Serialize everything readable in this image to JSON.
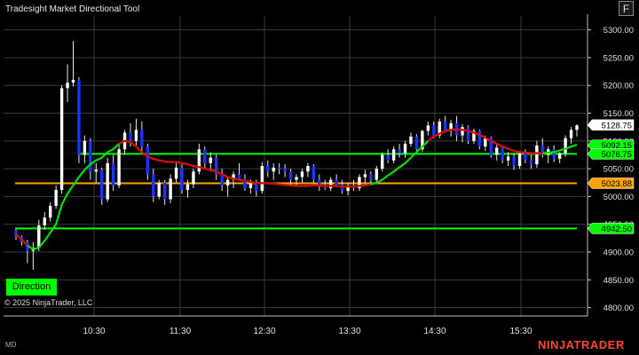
{
  "window": {
    "title": "Tradesight Market Directional Tool",
    "float_button": "F",
    "copyright": "© 2025 NinjaTrader, LLC",
    "direction_button": "Direction",
    "mode": "MD",
    "brand": "NINJATRADER"
  },
  "chart_data": {
    "type": "candlestick",
    "x_ticks": [
      "10:30",
      "11:30",
      "12:30",
      "13:30",
      "14:30",
      "15:30"
    ],
    "y_ticks": [
      "5300.00",
      "5250.00",
      "5200.00",
      "5150.00",
      "5100.00",
      "5050.00",
      "5000.00",
      "4950.00",
      "4900.00",
      "4850.00",
      "4800.00"
    ],
    "ylim": [
      4785,
      5325
    ],
    "y_tick_values": [
      5300,
      5250,
      5200,
      5150,
      5100,
      5050,
      5000,
      4950,
      4900,
      4850,
      4800
    ],
    "price_markers": [
      {
        "label": "5128.75",
        "value": 5128.75,
        "color": "#ffffff",
        "text_color": "#000000"
      },
      {
        "label": "5092.15",
        "value": 5092.15,
        "color": "#00ff00",
        "text_color": "#000000"
      },
      {
        "label": "5076.75",
        "value": 5076.75,
        "color": "#00ff00",
        "text_color": "#000000"
      },
      {
        "label": "5023.88",
        "value": 5023.88,
        "color": "#ffa500",
        "text_color": "#000000"
      },
      {
        "label": "4942.50",
        "value": 4942.5,
        "color": "#00ff00",
        "text_color": "#000000"
      }
    ],
    "horizontal_levels": [
      {
        "value": 5076.75,
        "color": "#00ff00",
        "start": 0.13
      },
      {
        "value": 5023.88,
        "color": "#ffa500",
        "start": 0.02
      },
      {
        "value": 4942.5,
        "color": "#00ff00",
        "start": 0.02
      }
    ],
    "candles": [
      [
        4940,
        4942,
        4922,
        4928
      ],
      [
        4928,
        4930,
        4912,
        4918
      ],
      [
        4918,
        4922,
        4880,
        4902
      ],
      [
        4902,
        4918,
        4868,
        4908
      ],
      [
        4908,
        4958,
        4902,
        4948
      ],
      [
        4948,
        4972,
        4940,
        4962
      ],
      [
        4962,
        4990,
        4955,
        4983
      ],
      [
        4983,
        5020,
        4978,
        5012
      ],
      [
        5012,
        5200,
        5005,
        5195
      ],
      [
        5195,
        5238,
        5170,
        5205
      ],
      [
        5205,
        5280,
        5198,
        5210
      ],
      [
        5210,
        5215,
        5060,
        5075
      ],
      [
        5075,
        5110,
        5060,
        5100
      ],
      [
        5100,
        5105,
        5030,
        5045
      ],
      [
        5045,
        5060,
        5025,
        5048
      ],
      [
        5048,
        5052,
        4985,
        4995
      ],
      [
        4995,
        5070,
        4990,
        5060
      ],
      [
        5060,
        5075,
        5010,
        5020
      ],
      [
        5020,
        5095,
        5015,
        5085
      ],
      [
        5085,
        5120,
        5075,
        5115
      ],
      [
        5115,
        5132,
        5090,
        5100
      ],
      [
        5100,
        5140,
        5092,
        5120
      ],
      [
        5120,
        5135,
        5080,
        5090
      ],
      [
        5090,
        5095,
        5030,
        5040
      ],
      [
        5040,
        5050,
        4990,
        5000
      ],
      [
        5000,
        5030,
        4995,
        5025
      ],
      [
        5025,
        5030,
        4985,
        4995
      ],
      [
        4995,
        5040,
        4988,
        5032
      ],
      [
        5032,
        5060,
        5025,
        5052
      ],
      [
        5052,
        5058,
        5005,
        5012
      ],
      [
        5012,
        5030,
        4998,
        5022
      ],
      [
        5022,
        5050,
        5015,
        5045
      ],
      [
        5045,
        5095,
        5040,
        5085
      ],
      [
        5085,
        5090,
        5050,
        5060
      ],
      [
        5060,
        5080,
        5045,
        5070
      ],
      [
        5070,
        5075,
        5030,
        5040
      ],
      [
        5040,
        5050,
        5010,
        5020
      ],
      [
        5020,
        5035,
        5000,
        5030
      ],
      [
        5030,
        5045,
        5015,
        5040
      ],
      [
        5040,
        5060,
        5030,
        5032
      ],
      [
        5032,
        5040,
        5010,
        5015
      ],
      [
        5015,
        5030,
        5005,
        5025
      ],
      [
        5025,
        5030,
        5000,
        5010
      ],
      [
        5010,
        5062,
        5005,
        5055
      ],
      [
        5055,
        5065,
        5035,
        5045
      ],
      [
        5045,
        5060,
        5030,
        5052
      ],
      [
        5052,
        5060,
        5040,
        5050
      ],
      [
        5050,
        5058,
        5035,
        5045
      ],
      [
        5045,
        5050,
        5020,
        5030
      ],
      [
        5030,
        5040,
        5020,
        5035
      ],
      [
        5035,
        5050,
        5025,
        5045
      ],
      [
        5045,
        5060,
        5035,
        5055
      ],
      [
        5055,
        5058,
        5025,
        5030
      ],
      [
        5030,
        5040,
        5010,
        5020
      ],
      [
        5020,
        5030,
        5012,
        5015
      ],
      [
        5015,
        5035,
        5010,
        5030
      ],
      [
        5030,
        5040,
        5020,
        5022
      ],
      [
        5022,
        5030,
        5005,
        5010
      ],
      [
        5010,
        5025,
        5002,
        5020
      ],
      [
        5020,
        5030,
        5010,
        5015
      ],
      [
        5015,
        5040,
        5010,
        5035
      ],
      [
        5035,
        5048,
        5025,
        5040
      ],
      [
        5040,
        5045,
        5020,
        5030
      ],
      [
        5030,
        5055,
        5025,
        5050
      ],
      [
        5050,
        5080,
        5045,
        5075
      ],
      [
        5075,
        5085,
        5060,
        5065
      ],
      [
        5065,
        5090,
        5060,
        5085
      ],
      [
        5085,
        5095,
        5070,
        5078
      ],
      [
        5078,
        5100,
        5070,
        5095
      ],
      [
        5095,
        5115,
        5090,
        5108
      ],
      [
        5108,
        5112,
        5080,
        5085
      ],
      [
        5085,
        5120,
        5080,
        5118
      ],
      [
        5118,
        5135,
        5110,
        5128
      ],
      [
        5128,
        5135,
        5105,
        5110
      ],
      [
        5110,
        5140,
        5105,
        5135
      ],
      [
        5135,
        5145,
        5115,
        5120
      ],
      [
        5120,
        5138,
        5108,
        5132
      ],
      [
        5132,
        5145,
        5100,
        5110
      ],
      [
        5110,
        5130,
        5098,
        5125
      ],
      [
        5125,
        5128,
        5095,
        5100
      ],
      [
        5100,
        5122,
        5095,
        5118
      ],
      [
        5118,
        5120,
        5085,
        5090
      ],
      [
        5090,
        5110,
        5082,
        5105
      ],
      [
        5105,
        5108,
        5070,
        5075
      ],
      [
        5075,
        5095,
        5065,
        5088
      ],
      [
        5088,
        5092,
        5060,
        5065
      ],
      [
        5065,
        5080,
        5055,
        5072
      ],
      [
        5072,
        5078,
        5048,
        5055
      ],
      [
        5055,
        5082,
        5050,
        5078
      ],
      [
        5078,
        5085,
        5060,
        5066
      ],
      [
        5066,
        5075,
        5050,
        5058
      ],
      [
        5058,
        5100,
        5052,
        5092
      ],
      [
        5092,
        5105,
        5070,
        5075
      ],
      [
        5075,
        5090,
        5060,
        5085
      ],
      [
        5085,
        5092,
        5062,
        5068
      ],
      [
        5068,
        5080,
        5060,
        5078
      ],
      [
        5078,
        5110,
        5072,
        5105
      ],
      [
        5105,
        5125,
        5095,
        5120
      ],
      [
        5120,
        5130,
        5108,
        5128
      ]
    ],
    "ma_line": [
      4932,
      4922,
      4912,
      4905,
      4908,
      4920,
      4935,
      4950,
      4985,
      5005,
      5020,
      5035,
      5048,
      5058,
      5065,
      5070,
      5080,
      5085,
      5095,
      5100,
      5098,
      5090,
      5080,
      5072,
      5068,
      5065,
      5063,
      5062,
      5062,
      5060,
      5058,
      5055,
      5053,
      5050,
      5048,
      5045,
      5040,
      5035,
      5032,
      5030,
      5028,
      5026,
      5024,
      5024,
      5024,
      5023,
      5022,
      5021,
      5020,
      5019,
      5019,
      5019,
      5020,
      5020,
      5019,
      5019,
      5019,
      5018,
      5018,
      5018,
      5019,
      5020,
      5022,
      5025,
      5030,
      5038,
      5045,
      5053,
      5060,
      5070,
      5080,
      5090,
      5100,
      5108,
      5113,
      5118,
      5120,
      5121,
      5120,
      5118,
      5115,
      5111,
      5106,
      5100,
      5095,
      5090,
      5086,
      5082,
      5080,
      5079,
      5078,
      5078,
      5078,
      5079,
      5080,
      5083,
      5086,
      5090,
      5093
    ],
    "ma_red_segments": [
      [
        0,
        2
      ],
      [
        18,
        62
      ],
      [
        72,
        92
      ]
    ]
  }
}
